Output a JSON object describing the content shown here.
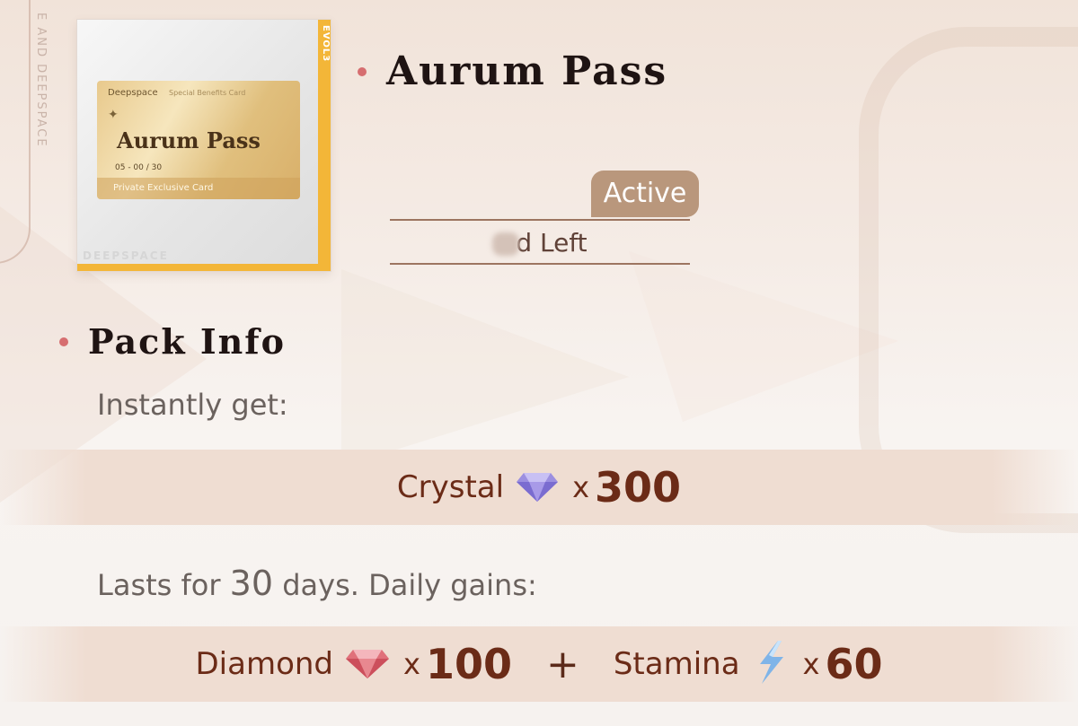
{
  "card": {
    "side_label": "EVOL3",
    "watermark": "DEEPSPACE",
    "brand": "Deepspace",
    "brand_sub": "Special Benefits Card",
    "title": "Aurum Pass",
    "number": "05 - 00 / 30",
    "footer": "Private Exclusive Card"
  },
  "side_text": "E AND DEEPSPACE",
  "pass": {
    "title": "Aurum Pass",
    "status": "Active",
    "remaining_suffix": "d Left"
  },
  "pack": {
    "title": "Pack Info",
    "instant_label": "Instantly get:",
    "instant_rewards": [
      {
        "name": "Crystal",
        "icon": "crystal-icon",
        "x": "x",
        "qty": "300",
        "color": "#9c8fe0"
      }
    ],
    "lasts_prefix": "Lasts for ",
    "lasts_days": "30",
    "lasts_suffix": " days. Daily gains:",
    "daily_rewards": [
      {
        "name": "Diamond",
        "icon": "diamond-icon",
        "x": "x",
        "qty": "100",
        "color": "#e0707a"
      },
      {
        "name": "Stamina",
        "icon": "lightning-icon",
        "x": "x",
        "qty": "60",
        "color": "#7fb4e8"
      }
    ],
    "plus": "+"
  },
  "colors": {
    "accent_dot": "#d66e70",
    "badge": "#b9977c",
    "reward_text": "#6b2b17",
    "card_gold": "#f3b638"
  }
}
